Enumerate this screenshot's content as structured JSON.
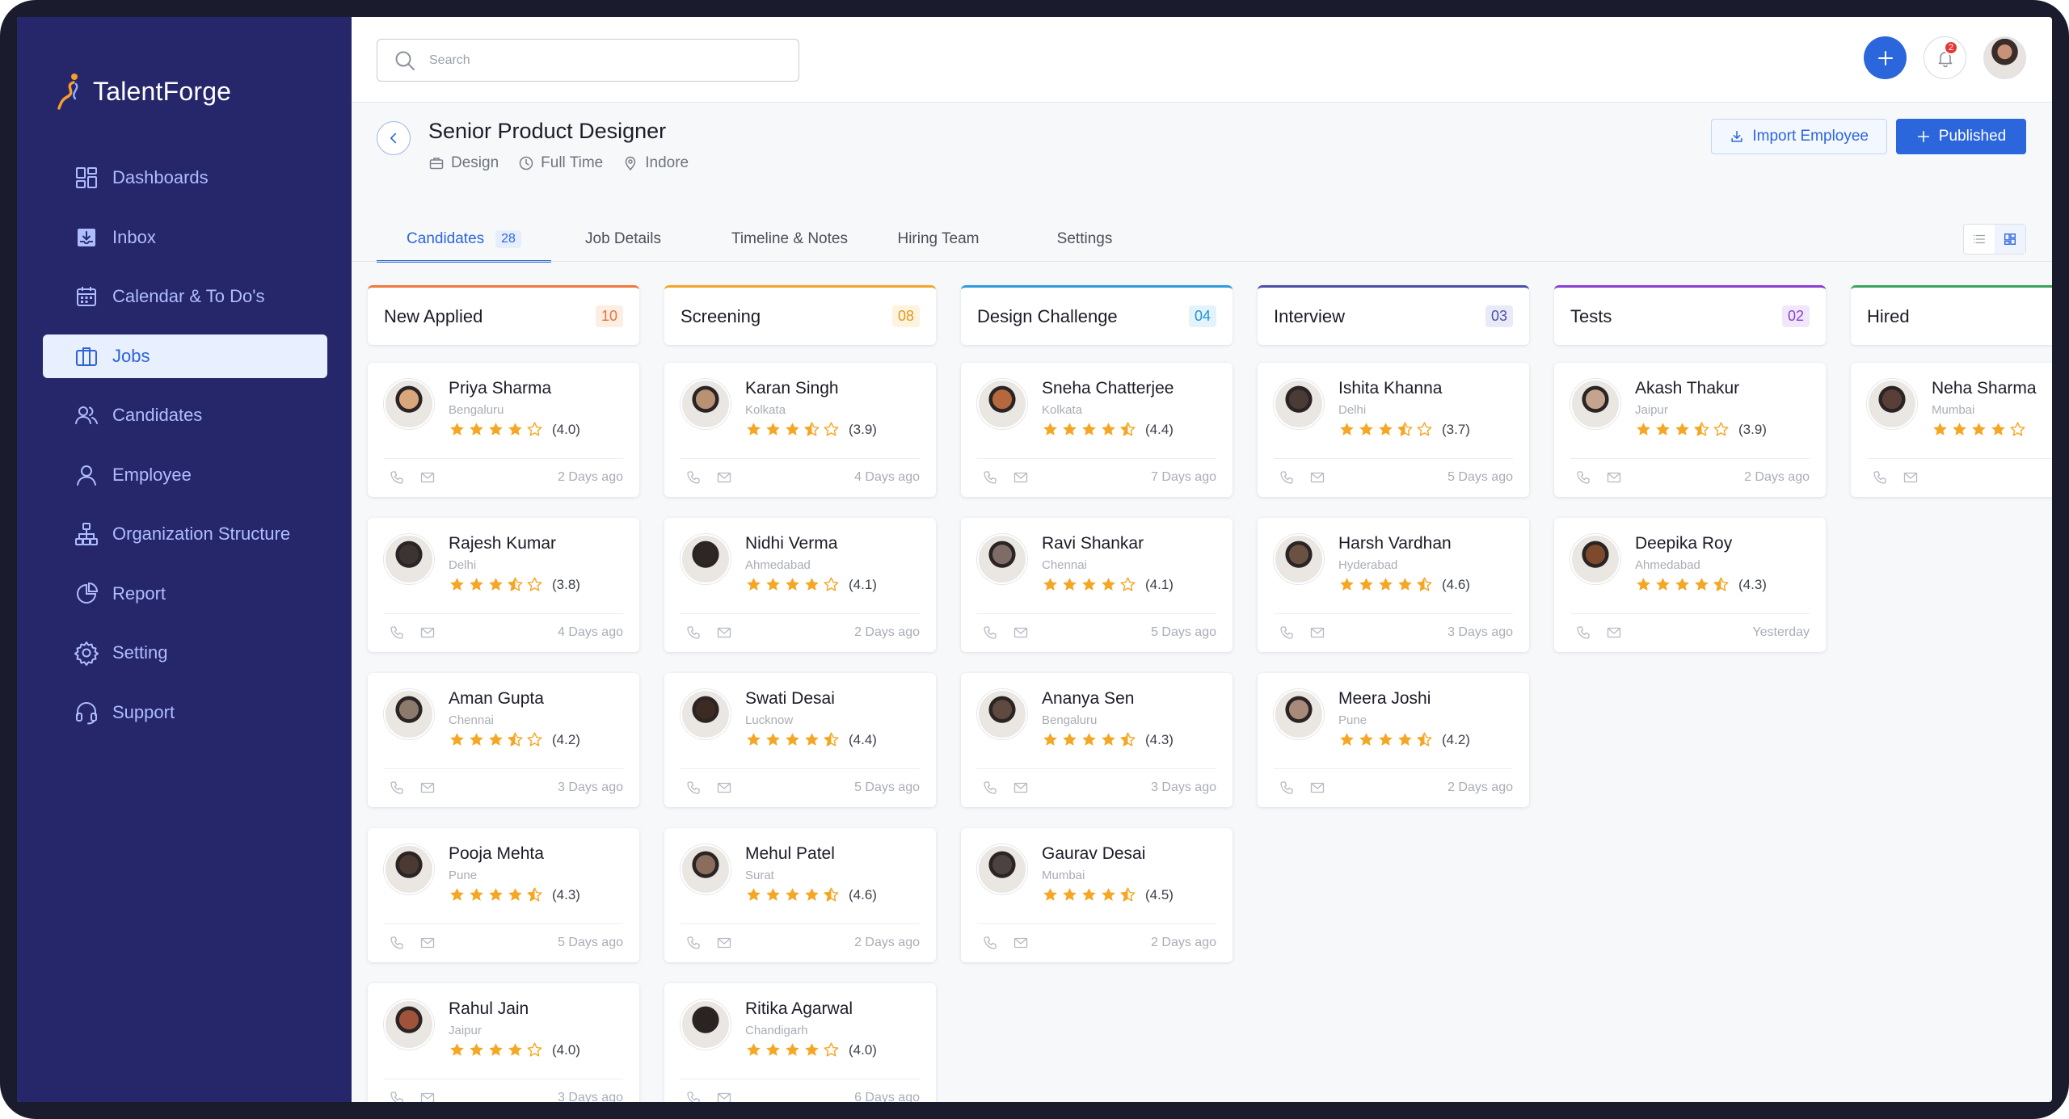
{
  "app": {
    "name": "TalentForge"
  },
  "sidebar": {
    "items": [
      {
        "label": "Dashboards",
        "icon": "dashboard-icon"
      },
      {
        "label": "Inbox",
        "icon": "inbox-icon"
      },
      {
        "label": "Calendar & To Do's",
        "icon": "calendar-icon"
      },
      {
        "label": "Jobs",
        "icon": "briefcase-icon",
        "active": true
      },
      {
        "label": "Candidates",
        "icon": "users-icon"
      },
      {
        "label": "Employee",
        "icon": "user-icon"
      },
      {
        "label": "Organization Structure",
        "icon": "org-chart-icon"
      },
      {
        "label": "Report",
        "icon": "pie-chart-icon"
      },
      {
        "label": "Setting",
        "icon": "gear-icon"
      },
      {
        "label": "Support",
        "icon": "headset-icon"
      }
    ]
  },
  "topbar": {
    "search_placeholder": "Search",
    "notification_count": "2"
  },
  "job": {
    "title": "Senior Product Designer",
    "department": "Design",
    "type": "Full Time",
    "location": "Indore",
    "import_label": "Import Employee",
    "publish_label": "Published"
  },
  "tabs": [
    {
      "label": "Candidates",
      "count": "28",
      "active": true
    },
    {
      "label": "Job Details"
    },
    {
      "label": "Timeline & Notes"
    },
    {
      "label": "Hiring Team"
    },
    {
      "label": "Settings"
    }
  ],
  "columns": [
    {
      "title": "New Applied",
      "count": "10",
      "accent": "#f07a3e",
      "badge_bg": "#fdeee4",
      "badge_fg": "#e8743a",
      "cards": [
        {
          "name": "Priya Sharma",
          "city": "Bengaluru",
          "rating": 4.0,
          "score": "(4.0)",
          "time": "2 Days ago",
          "tone": "#d9a77c"
        },
        {
          "name": "Rajesh Kumar",
          "city": "Delhi",
          "rating": 3.5,
          "score": "(3.8)",
          "time": "4 Days ago",
          "tone": "#3b3433"
        },
        {
          "name": "Aman Gupta",
          "city": "Chennai",
          "rating": 3.5,
          "score": "(4.2)",
          "time": "3 Days ago",
          "tone": "#8c7a6d"
        },
        {
          "name": "Pooja Mehta",
          "city": "Pune",
          "rating": 4.5,
          "score": "(4.3)",
          "time": "5 Days ago",
          "tone": "#4a3a33"
        },
        {
          "name": "Rahul Jain",
          "city": "Jaipur",
          "rating": 4.0,
          "score": "(4.0)",
          "time": "3 Days ago",
          "tone": "#a0523b"
        }
      ]
    },
    {
      "title": "Screening",
      "count": "08",
      "accent": "#f3a524",
      "badge_bg": "#fdf3df",
      "badge_fg": "#e09a1c",
      "cards": [
        {
          "name": "Karan Singh",
          "city": "Kolkata",
          "rating": 3.5,
          "score": "(3.9)",
          "time": "4 Days ago",
          "tone": "#b89272"
        },
        {
          "name": "Nidhi Verma",
          "city": "Ahmedabad",
          "rating": 4.0,
          "score": "(4.1)",
          "time": "2 Days ago",
          "tone": "#2e2624"
        },
        {
          "name": "Swati Desai",
          "city": "Lucknow",
          "rating": 4.5,
          "score": "(4.4)",
          "time": "5 Days ago",
          "tone": "#3d2a22"
        },
        {
          "name": "Mehul Patel",
          "city": "Surat",
          "rating": 4.5,
          "score": "(4.6)",
          "time": "2 Days ago",
          "tone": "#8a6d5c"
        },
        {
          "name": "Ritika Agarwal",
          "city": "Chandigarh",
          "rating": 4.0,
          "score": "(4.0)",
          "time": "6 Days ago",
          "tone": "#2b2222"
        }
      ]
    },
    {
      "title": "Design Challenge",
      "count": "04",
      "accent": "#2d9cdb",
      "badge_bg": "#e3f3fc",
      "badge_fg": "#2692d1",
      "cards": [
        {
          "name": "Sneha Chatterjee",
          "city": "Kolkata",
          "rating": 4.5,
          "score": "(4.4)",
          "time": "7 Days ago",
          "tone": "#b5683e"
        },
        {
          "name": "Ravi Shankar",
          "city": "Chennai",
          "rating": 4.0,
          "score": "(4.1)",
          "time": "5 Days ago",
          "tone": "#7e6d66"
        },
        {
          "name": "Ananya Sen",
          "city": "Bengaluru",
          "rating": 4.5,
          "score": "(4.3)",
          "time": "3 Days ago",
          "tone": "#5e4a40"
        },
        {
          "name": "Gaurav Desai",
          "city": "Mumbai",
          "rating": 4.5,
          "score": "(4.5)",
          "time": "2 Days ago",
          "tone": "#4d4240"
        }
      ]
    },
    {
      "title": "Interview",
      "count": "03",
      "accent": "#4b4fa8",
      "badge_bg": "#e9eaf7",
      "badge_fg": "#4b4fa8",
      "cards": [
        {
          "name": "Ishita Khanna",
          "city": "Delhi",
          "rating": 3.5,
          "score": "(3.7)",
          "time": "5 Days ago",
          "tone": "#4b3b36"
        },
        {
          "name": "Harsh Vardhan",
          "city": "Hyderabad",
          "rating": 4.5,
          "score": "(4.6)",
          "time": "3 Days ago",
          "tone": "#6b5142"
        },
        {
          "name": "Meera Joshi",
          "city": "Pune",
          "rating": 4.5,
          "score": "(4.2)",
          "time": "2 Days ago",
          "tone": "#a98a7a"
        }
      ]
    },
    {
      "title": "Tests",
      "count": "02",
      "accent": "#8a3fd1",
      "badge_bg": "#f1e7fb",
      "badge_fg": "#8a3fd1",
      "cards": [
        {
          "name": "Akash Thakur",
          "city": "Jaipur",
          "rating": 3.5,
          "score": "(3.9)",
          "time": "2 Days ago",
          "tone": "#c4a38f"
        },
        {
          "name": "Deepika Roy",
          "city": "Ahmedabad",
          "rating": 4.5,
          "score": "(4.3)",
          "time": "Yesterday",
          "tone": "#7d4a2e"
        }
      ]
    },
    {
      "title": "Hired",
      "count": "",
      "accent": "#3aa55b",
      "badge_bg": "#e3f5e8",
      "badge_fg": "#3aa55b",
      "cards": [
        {
          "name": "Neha Sharma",
          "city": "Mumbai",
          "rating": 4.0,
          "score": "",
          "time": "",
          "tone": "#5a3f38"
        }
      ]
    }
  ]
}
